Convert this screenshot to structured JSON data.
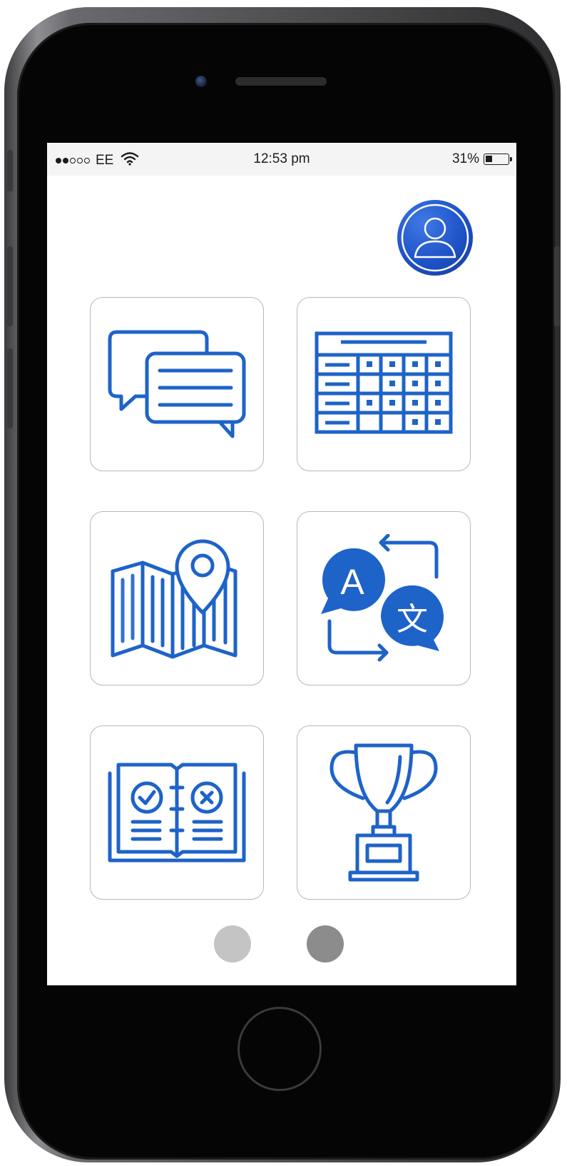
{
  "status_bar": {
    "signal_bars": {
      "filled": 2,
      "total": 5
    },
    "carrier": "EE",
    "time": "12:53 pm",
    "battery_percent": "31%",
    "battery_level": 0.31
  },
  "profile": {
    "icon": "user-profile-icon"
  },
  "tiles": [
    {
      "icon": "chat-bubbles-icon"
    },
    {
      "icon": "calendar-grid-icon"
    },
    {
      "icon": "map-location-icon"
    },
    {
      "icon": "translate-icon",
      "glyph_a": "A",
      "glyph_b": "文"
    },
    {
      "icon": "quiz-book-icon"
    },
    {
      "icon": "trophy-icon"
    }
  ],
  "pagination": {
    "pages": 2,
    "current": 2
  },
  "colors": {
    "accent": "#1e63c8",
    "avatar_bg": "#1e52c7",
    "tile_border": "#b8b8b8",
    "page_dot_inactive": "#c4c4c4",
    "page_dot_active": "#8c8c8c"
  }
}
